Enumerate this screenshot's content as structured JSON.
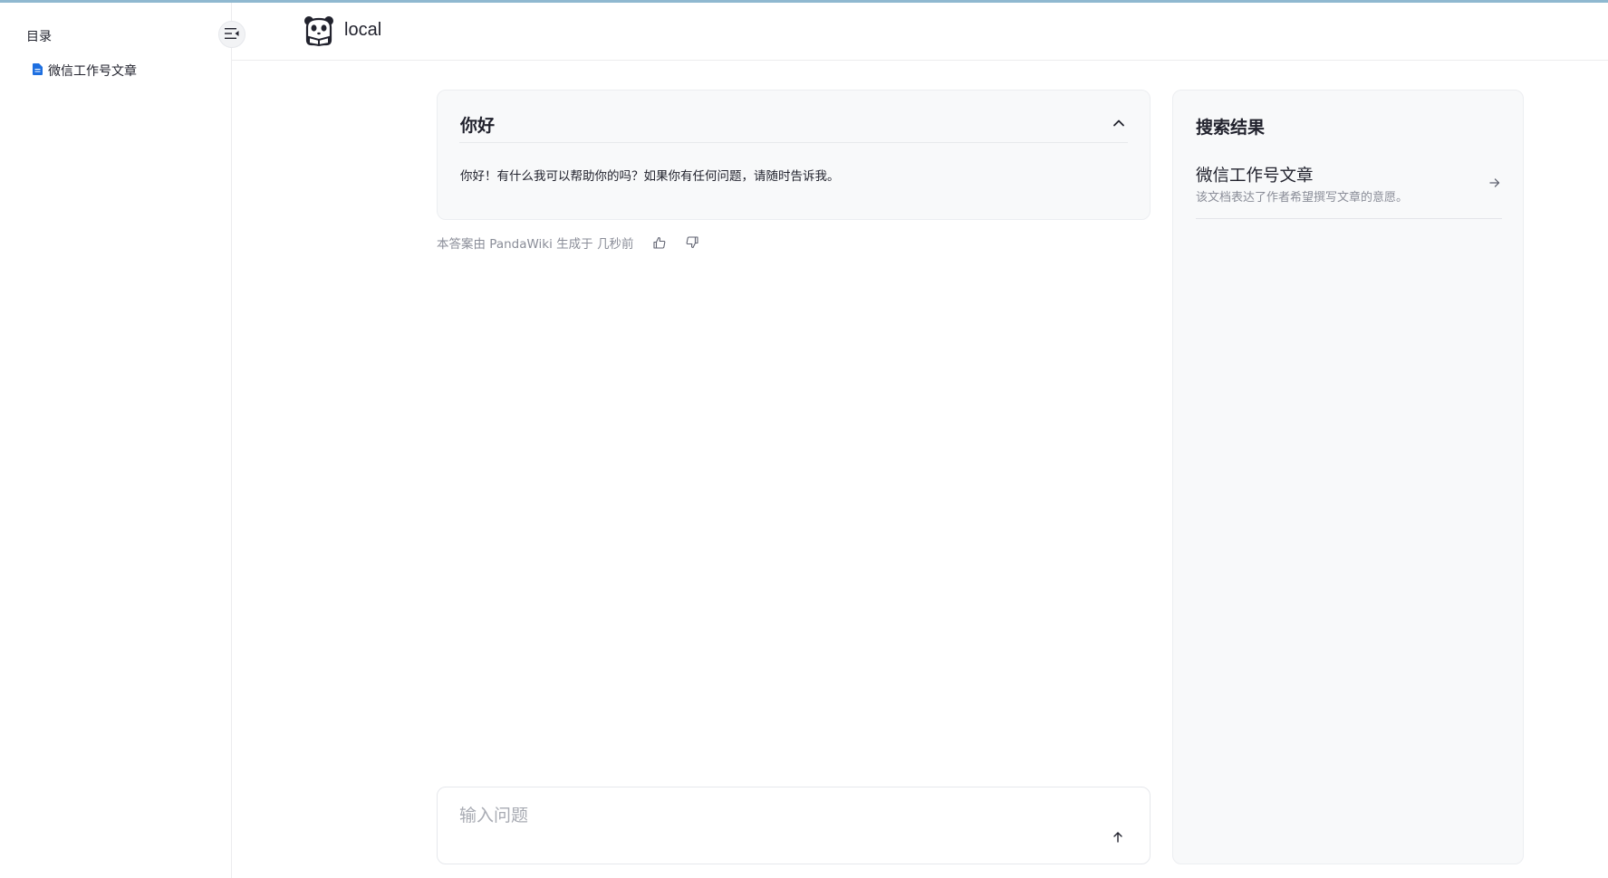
{
  "sidebar": {
    "title": "目录",
    "items": [
      {
        "label": "微信工作号文章",
        "icon": "document-icon"
      }
    ]
  },
  "header": {
    "site_name": "local",
    "logo": "panda-logo-icon"
  },
  "answer": {
    "question": "你好",
    "text": "你好！有什么我可以帮助你的吗？如果你有任何问题，请随时告诉我。",
    "meta": "本答案由 PandaWiki 生成于 几秒前"
  },
  "input": {
    "placeholder": "输入问题"
  },
  "results": {
    "title": "搜索结果",
    "items": [
      {
        "name": "微信工作号文章",
        "desc": "该文档表达了作者希望撰写文章的意愿。"
      }
    ]
  },
  "colors": {
    "accent": "#3248f2",
    "topline": "#8fb8d0",
    "doc_icon": "#1e6fe0"
  }
}
